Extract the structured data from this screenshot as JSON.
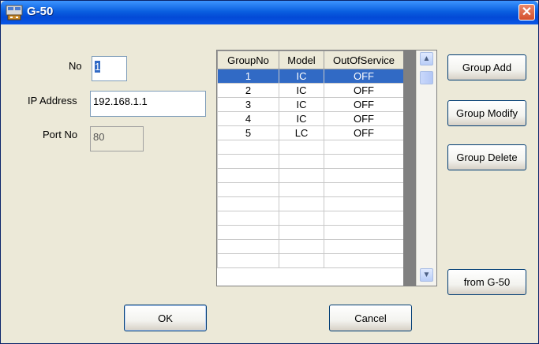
{
  "window": {
    "title": "G-50"
  },
  "form": {
    "no_label": "No",
    "no_value": "1",
    "ip_label": "IP Address",
    "ip_value": "192.168.1.1",
    "port_label": "Port No",
    "port_value": "80"
  },
  "table": {
    "columns": [
      "GroupNo",
      "Model",
      "OutOfService"
    ],
    "rows": [
      [
        "1",
        "IC",
        "OFF"
      ],
      [
        "2",
        "IC",
        "OFF"
      ],
      [
        "3",
        "IC",
        "OFF"
      ],
      [
        "4",
        "IC",
        "OFF"
      ],
      [
        "5",
        "LC",
        "OFF"
      ]
    ],
    "selected_row": 0,
    "empty_rows": 9
  },
  "buttons": {
    "group_add": "Group Add",
    "group_modify": "Group Modify",
    "group_delete": "Group Delete",
    "from_g50": "from G-50",
    "ok": "OK",
    "cancel": "Cancel"
  },
  "icons": {
    "app": "controller-icon",
    "close": "close-icon",
    "scroll_up": "scroll-up-icon",
    "scroll_down": "scroll-down-icon"
  },
  "colors": {
    "titlebar": "#0a5fe0",
    "selection": "#316ac5",
    "dialog_bg": "#ece9d8",
    "close": "#d4502c"
  }
}
